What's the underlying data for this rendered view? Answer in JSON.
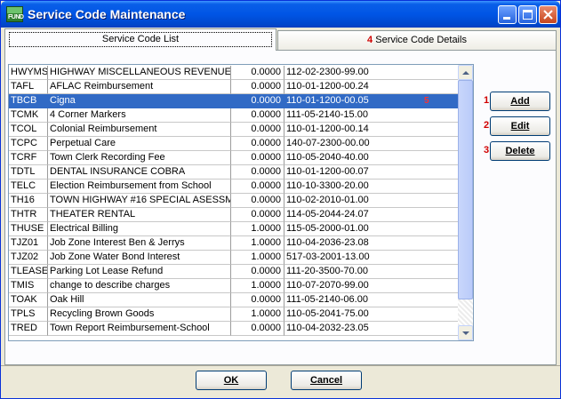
{
  "window": {
    "title": "Service Code Maintenance",
    "icon_text": "FUND",
    "controls": [
      "minimize-icon",
      "maximize-icon",
      "close-icon"
    ]
  },
  "tabs": [
    {
      "label": "Service Code List",
      "number": ""
    },
    {
      "label": "Service Code Details",
      "number": "4"
    }
  ],
  "grid": {
    "selected_row_marker": "5",
    "rows": [
      {
        "code": "HWYMS",
        "description": "HIGHWAY MISCELLANEOUS REVENUE",
        "amount": "0.0000",
        "account": "112-02-2300-99.00"
      },
      {
        "code": "TAFL",
        "description": "AFLAC Reimbursement",
        "amount": "0.0000",
        "account": "110-01-1200-00.24"
      },
      {
        "code": "TBCB",
        "description": "Cigna",
        "amount": "0.0000",
        "account": "110-01-1200-00.05"
      },
      {
        "code": "TCMK",
        "description": "4 Corner Markers",
        "amount": "0.0000",
        "account": "111-05-2140-15.00"
      },
      {
        "code": "TCOL",
        "description": "Colonial Reimbursement",
        "amount": "0.0000",
        "account": "110-01-1200-00.14"
      },
      {
        "code": "TCPC",
        "description": "Perpetual Care",
        "amount": "0.0000",
        "account": "140-07-2300-00.00"
      },
      {
        "code": "TCRF",
        "description": "Town Clerk Recording Fee",
        "amount": "0.0000",
        "account": "110-05-2040-40.00"
      },
      {
        "code": "TDTL",
        "description": "DENTAL INSURANCE COBRA",
        "amount": "0.0000",
        "account": "110-01-1200-00.07"
      },
      {
        "code": "TELC",
        "description": "Election Reimbursement from School",
        "amount": "0.0000",
        "account": "110-10-3300-20.00"
      },
      {
        "code": "TH16",
        "description": "TOWN HIGHWAY #16 SPECIAL ASESSME",
        "amount": "0.0000",
        "account": "110-02-2010-01.00"
      },
      {
        "code": "THTR",
        "description": "THEATER RENTAL",
        "amount": "0.0000",
        "account": "114-05-2044-24.07"
      },
      {
        "code": "THUSE",
        "description": "Electrical Billing",
        "amount": "1.0000",
        "account": "115-05-2000-01.00"
      },
      {
        "code": "TJZ01",
        "description": "Job Zone Interest Ben & Jerrys",
        "amount": "1.0000",
        "account": "110-04-2036-23.08"
      },
      {
        "code": "TJZ02",
        "description": "Job Zone Water Bond Interest",
        "amount": "1.0000",
        "account": "517-03-2001-13.00"
      },
      {
        "code": "TLEASE",
        "description": "Parking Lot Lease Refund",
        "amount": "0.0000",
        "account": "111-20-3500-70.00"
      },
      {
        "code": "TMIS",
        "description": "change to describe charges",
        "amount": "1.0000",
        "account": "110-07-2070-99.00"
      },
      {
        "code": "TOAK",
        "description": "Oak Hill",
        "amount": "0.0000",
        "account": "111-05-2140-06.00"
      },
      {
        "code": "TPLS",
        "description": "Recycling Brown Goods",
        "amount": "1.0000",
        "account": "110-05-2041-75.00"
      },
      {
        "code": "TRED",
        "description": "Town Report Reimbursement-School",
        "amount": "0.0000",
        "account": "110-04-2032-23.05"
      }
    ]
  },
  "side_buttons": [
    {
      "number": "1",
      "label": "Add"
    },
    {
      "number": "2",
      "label": "Edit"
    },
    {
      "number": "3",
      "label": "Delete"
    }
  ],
  "bottom_buttons": [
    {
      "label": "OK"
    },
    {
      "label": "Cancel"
    }
  ]
}
